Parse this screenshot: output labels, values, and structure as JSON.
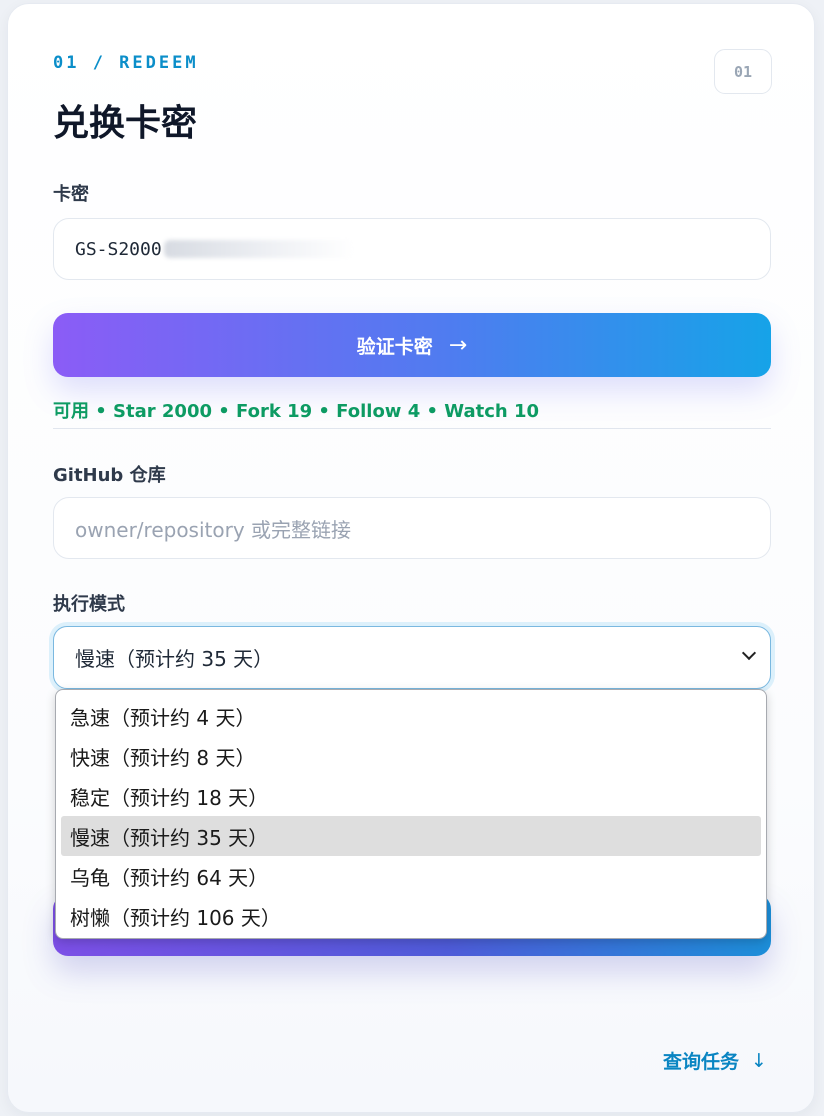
{
  "header": {
    "eyebrow": "01 / REDEEM",
    "step_badge": "01",
    "title": "兑换卡密"
  },
  "card_key": {
    "label": "卡密",
    "value_visible": "GS-S2000"
  },
  "verify_button": {
    "label": "验证卡密",
    "icon": "arrow-right-icon",
    "arrow_glyph": "→"
  },
  "status_line": "可用 • Star 2000 • Fork 19 • Follow 4 • Watch 10",
  "repo": {
    "label": "GitHub 仓库",
    "placeholder": "owner/repository 或完整链接"
  },
  "mode": {
    "label": "执行模式",
    "selected": "慢速（预计约 35 天）",
    "options": [
      "急速（预计约 4 天）",
      "快速（预计约 8 天）",
      "稳定（预计约 18 天）",
      "慢速（预计约 35 天）",
      "乌龟（预计约 64 天）",
      "树懒（预计约 106 天）"
    ],
    "selected_index": 3
  },
  "query_link": {
    "label": "查询任务",
    "icon": "arrow-down-icon",
    "arrow_glyph": "↓"
  },
  "colors": {
    "accent_blue": "#0b8ec9",
    "status_green": "#0d9b63",
    "gradient_start": "#8b5cf6",
    "gradient_end": "#16a3e8"
  }
}
